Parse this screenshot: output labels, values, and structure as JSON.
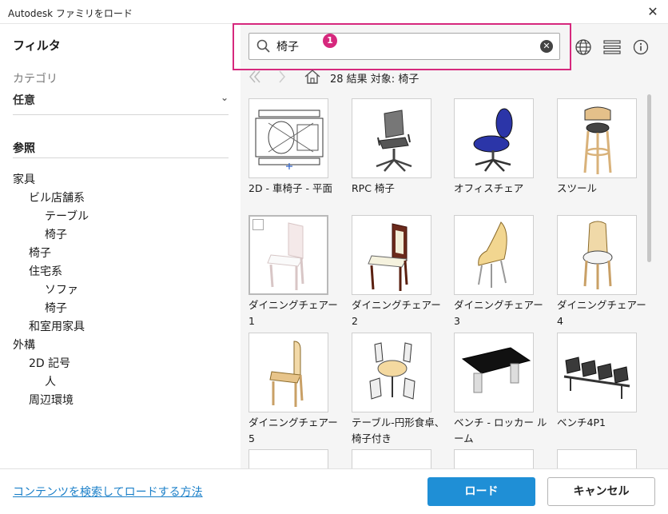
{
  "window": {
    "title": "Autodesk ファミリをロード"
  },
  "sidebar": {
    "filter_heading": "フィルタ",
    "category_label": "カテゴリ",
    "category_value": "任意",
    "browse_heading": "参照",
    "tree": [
      {
        "label": "家具",
        "level": 0
      },
      {
        "label": "ビル店舗系",
        "level": 1
      },
      {
        "label": "テーブル",
        "level": 2
      },
      {
        "label": "椅子",
        "level": 2
      },
      {
        "label": "椅子",
        "level": 1
      },
      {
        "label": "住宅系",
        "level": 1
      },
      {
        "label": "ソファ",
        "level": 2
      },
      {
        "label": "椅子",
        "level": 2
      },
      {
        "label": "和室用家具",
        "level": 1
      },
      {
        "label": "外構",
        "level": 0
      },
      {
        "label": "2D 記号",
        "level": 1
      },
      {
        "label": "人",
        "level": 2
      },
      {
        "label": "周辺環境",
        "level": 1
      }
    ]
  },
  "search": {
    "value": "椅子",
    "badge": "1"
  },
  "results": {
    "summary": "28 結果 対象: 椅子"
  },
  "items": [
    {
      "caption": "2D - 車椅子 - 平面",
      "icon": "wheelchair-plan"
    },
    {
      "caption": "RPC 椅子",
      "icon": "office-chair-gray"
    },
    {
      "caption": "オフィスチェア",
      "icon": "office-chair-blue"
    },
    {
      "caption": "スツール",
      "icon": "stool"
    },
    {
      "caption": "ダイニングチェアー1",
      "icon": "dining-chair-white"
    },
    {
      "caption": "ダイニングチェアー2",
      "icon": "dining-chair-brown"
    },
    {
      "caption": "ダイニングチェアー3",
      "icon": "dining-chair-shell"
    },
    {
      "caption": "ダイニングチェアー4",
      "icon": "dining-chair-round"
    },
    {
      "caption": "ダイニングチェアー5",
      "icon": "dining-chair-wood"
    },
    {
      "caption": "テーブル-円形食卓、椅子付き",
      "icon": "round-table-set"
    },
    {
      "caption": "ベンチ - ロッカー ルーム",
      "icon": "locker-bench"
    },
    {
      "caption": "ベンチ4P1",
      "icon": "bench-4-seat"
    }
  ],
  "footer": {
    "help_link": "コンテンツを検索してロードする方法",
    "load_label": "ロード",
    "cancel_label": "キャンセル"
  },
  "colors": {
    "accent": "#1f8fd6",
    "highlight": "#d6287d",
    "chair_blue": "#2b35a8"
  }
}
